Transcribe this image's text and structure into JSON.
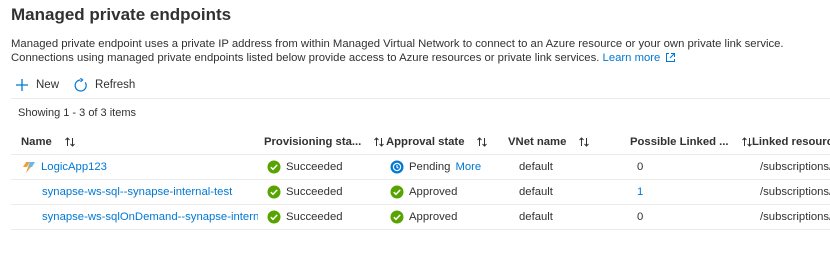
{
  "page": {
    "title": "Managed private endpoints",
    "description_text": "Managed private endpoint uses a private IP address from within Managed Virtual Network to connect to an Azure resource or your own private link service. Connections using managed private endpoints listed below provide access to Azure resources or private link services.",
    "learn_more_label": "Learn more"
  },
  "toolbar": {
    "new_label": "New",
    "refresh_label": "Refresh"
  },
  "grid": {
    "count_text": "Showing 1 - 3 of 3 items",
    "columns": [
      {
        "label": "Name"
      },
      {
        "label": "Provisioning sta..."
      },
      {
        "label": "Approval state"
      },
      {
        "label": "VNet name"
      },
      {
        "label": "Possible Linked ..."
      },
      {
        "label": "Linked resource I"
      }
    ],
    "rows": [
      {
        "name": "LogicApp123",
        "provisioning": "Succeeded",
        "approval": "Pending",
        "approval_more": "More",
        "vnet": "default",
        "possible_linked": "0",
        "linked_resource": "/subscriptions/c"
      },
      {
        "name": "synapse-ws-sql--synapse-internal-test",
        "provisioning": "Succeeded",
        "approval": "Approved",
        "approval_more": "",
        "vnet": "default",
        "possible_linked": "1",
        "linked_resource": "/subscriptions/c"
      },
      {
        "name": "synapse-ws-sqlOnDemand--synapse-interna...",
        "provisioning": "Succeeded",
        "approval": "Approved",
        "approval_more": "",
        "vnet": "default",
        "possible_linked": "0",
        "linked_resource": "/subscriptions/c"
      }
    ]
  },
  "colors": {
    "link": "#0078d4",
    "success": "#57a300",
    "pending": "#0078d4",
    "text": "#323130",
    "border": "#edebe9"
  },
  "icons": {
    "new": "plus-icon",
    "refresh": "refresh-icon",
    "sort": "sort-icon",
    "succeeded": "check-circle-icon",
    "approved": "check-circle-icon",
    "pending": "pending-icon",
    "logic_app": "logic-app-icon",
    "external": "external-link-icon"
  }
}
